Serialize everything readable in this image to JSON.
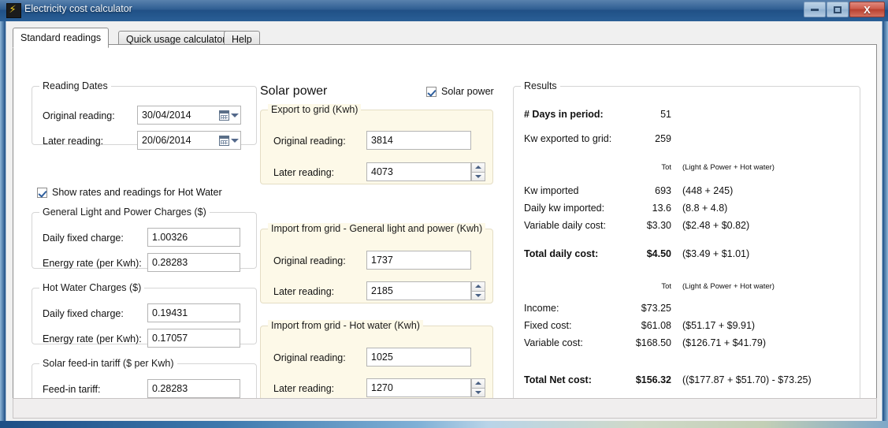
{
  "window": {
    "title": "Electricity cost calculator",
    "icon": "lightning-bolt-icon",
    "minimize_label": "Minimize",
    "maximize_label": "Maximize",
    "close_label": "X"
  },
  "tabs": [
    {
      "label": "Standard readings",
      "active": true
    },
    {
      "label": "Quick usage calculator",
      "active": false
    },
    {
      "label": "Help",
      "active": false
    }
  ],
  "reading_dates": {
    "group_title": "Reading Dates",
    "original_label": "Original reading:",
    "original_value": "30/04/2014",
    "later_label": "Later reading:",
    "later_value": "20/06/2014"
  },
  "hot_water_checkbox": {
    "label": "Show rates and readings for Hot Water",
    "checked": true
  },
  "general_charges": {
    "group_title": "General Light and Power Charges ($)",
    "daily_fixed_label": "Daily fixed charge:",
    "daily_fixed_value": "1.00326",
    "energy_rate_label": "Energy rate (per Kwh):",
    "energy_rate_value": "0.28283"
  },
  "hot_water_charges": {
    "group_title": "Hot Water Charges ($)",
    "daily_fixed_label": "Daily fixed charge:",
    "daily_fixed_value": "0.19431",
    "energy_rate_label": "Energy rate (per Kwh):",
    "energy_rate_value": "0.17057"
  },
  "solar_tariff": {
    "group_title": "Solar feed-in tariff ($ per Kwh)",
    "feed_in_label": "Feed-in tariff:",
    "feed_in_value": "0.28283"
  },
  "solar": {
    "heading": "Solar power",
    "checkbox_label": "Solar power",
    "checkbox_checked": true,
    "export_group": {
      "title": "Export to grid (Kwh)",
      "original_label": "Original reading:",
      "original_value": "3814",
      "later_label": "Later reading:",
      "later_value": "4073"
    },
    "import_glp_group": {
      "title": "Import from grid - General light and power (Kwh)",
      "original_label": "Original reading:",
      "original_value": "1737",
      "later_label": "Later reading:",
      "later_value": "2185"
    },
    "import_hw_group": {
      "title": "Import from grid - Hot water (Kwh)",
      "original_label": "Original reading:",
      "original_value": "1025",
      "later_label": "Later reading:",
      "later_value": "1270"
    }
  },
  "results": {
    "group_title": "Results",
    "days_label": "# Days in period:",
    "days_value": "51",
    "exported_label": "Kw exported to grid:",
    "exported_value": "259",
    "col_tot_1": "Tot",
    "col_breakdown_1": "(Light & Power + Hot water)",
    "rows_usage": [
      {
        "label": "Kw imported",
        "total": "693",
        "breakdown": "(448 + 245)",
        "bold": false
      },
      {
        "label": "Daily kw imported:",
        "total": "13.6",
        "breakdown": "(8.8 + 4.8)",
        "bold": false
      },
      {
        "label": "Variable daily cost:",
        "total": "$3.30",
        "breakdown": "($2.48 + $0.82)",
        "bold": false
      }
    ],
    "total_daily": {
      "label": "Total daily cost:",
      "total": "$4.50",
      "breakdown": "($3.49 + $1.01)"
    },
    "col_tot_2": "Tot",
    "col_breakdown_2": "(Light & Power + Hot water)",
    "rows_cost": [
      {
        "label": "Income:",
        "total": "$73.25",
        "breakdown": ""
      },
      {
        "label": "Fixed cost:",
        "total": "$61.08",
        "breakdown": "($51.17 + $9.91)"
      },
      {
        "label": "Variable cost:",
        "total": "$168.50",
        "breakdown": "($126.71 + $41.79)"
      }
    ],
    "total_net": {
      "label": "Total Net cost:",
      "total": "$156.32",
      "breakdown": "(($177.87 + $51.70) - $73.25)"
    }
  }
}
